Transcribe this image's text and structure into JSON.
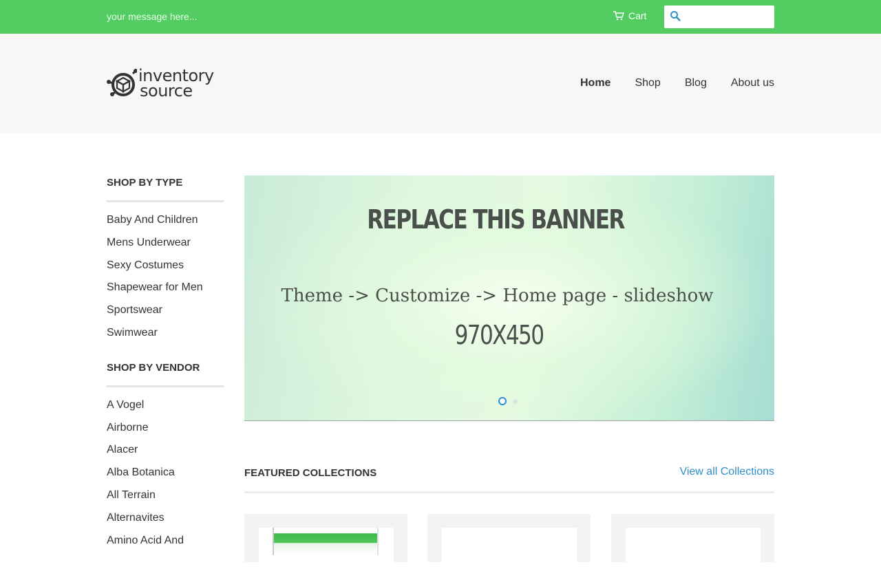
{
  "topbar": {
    "message": "your message here...",
    "cart_label": "Cart",
    "search_placeholder": ""
  },
  "brand": {
    "line1": "inventory",
    "line2": "source"
  },
  "nav": {
    "items": [
      "Home",
      "Shop",
      "Blog",
      "About us"
    ],
    "active": "Home"
  },
  "sidebar": {
    "type_heading": "SHOP BY TYPE",
    "type_items": [
      "Baby And Children",
      "Mens Underwear",
      "Sexy Costumes",
      "Shapewear for Men",
      "Sportswear",
      "Swimwear"
    ],
    "vendor_heading": "SHOP BY VENDOR",
    "vendor_items": [
      "A Vogel",
      "Airborne",
      "Alacer",
      "Alba Botanica",
      "All Terrain",
      "Alternavites",
      "Amino Acid And"
    ]
  },
  "banner": {
    "title": "REPLACE THIS BANNER",
    "subtitle": "Theme -> Customize -> Home page - slideshow",
    "size": "970X450",
    "slides": 2,
    "active_slide": 1
  },
  "featured": {
    "title": "FEATURED COLLECTIONS",
    "view_all": "View all Collections"
  },
  "colors": {
    "topbar": "#53cd62",
    "link": "#2f8fc8",
    "header_bg": "#f7f7f7"
  }
}
